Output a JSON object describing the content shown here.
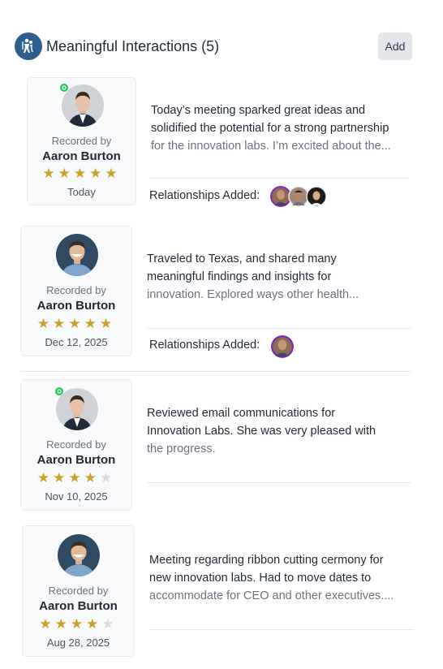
{
  "header": {
    "title": "Meaningful Interactions (5)",
    "add_label": "Add",
    "icon": "people-icon"
  },
  "interactions": [
    {
      "recorded_by_label": "Recorded by",
      "name": "Aaron Burton",
      "rating": 5,
      "date": "Today",
      "online": true,
      "lines": [
        "Today’s meeting sparked great ideas and",
        "solidified the potential for a strong partnership",
        "for the innovation labs. I’m excited about the..."
      ],
      "relationships_label": "Relationships Added:"
    },
    {
      "recorded_by_label": "Recorded by",
      "name": "Aaron Burton",
      "rating": 5,
      "date": "Dec 12, 2025",
      "online": false,
      "lines": [
        "Traveled to Texas, and shared many",
        "meaningful findings and insights for",
        "innovation. Explored ways other health..."
      ],
      "relationships_label": "Relationships Added:"
    },
    {
      "recorded_by_label": "Recorded by",
      "name": "Aaron Burton",
      "rating": 4,
      "date": "Nov 10, 2025",
      "online": true,
      "lines": [
        "Reviewed email communications for",
        "Innovation Labs. She was very pleased with",
        "the progress."
      ]
    },
    {
      "recorded_by_label": "Recorded by",
      "name": "Aaron Burton",
      "rating": 4,
      "date": "Aug 28, 2025",
      "online": false,
      "lines": [
        "Meeting regarding ribbon cutting cermony for",
        "new innovation labs. Had to move dates to",
        "accommodate for CEO and other executives...."
      ]
    }
  ],
  "colors": {
    "star_on": "#c9a227",
    "star_off": "#d7dbe0",
    "online": "#22c55e",
    "avatar_ring": "#7e22ce"
  }
}
